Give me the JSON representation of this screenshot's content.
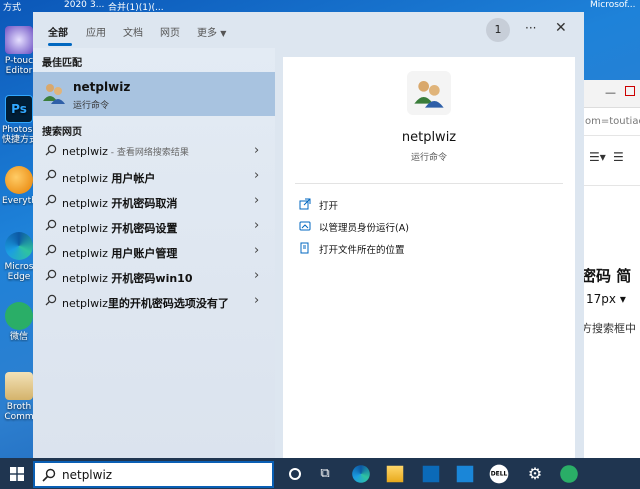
{
  "desktop": {
    "top_strip": [
      "方式",
      "2020",
      "3...",
      "合并(1)(1)(...",
      "Microsof..."
    ],
    "icons": [
      {
        "label": "P-touch Editor",
        "lines": [
          "P-touc",
          "Editor"
        ]
      },
      {
        "label": "Photoshop 快捷方式",
        "lines": [
          "Photosh",
          "快捷方式"
        ]
      },
      {
        "label": "Everything",
        "lines": [
          "Everythi"
        ]
      },
      {
        "label": "Microsoft Edge",
        "lines": [
          "Micros",
          "Edge"
        ]
      },
      {
        "label": "微信",
        "lines": [
          "微信"
        ]
      },
      {
        "label": "Brother Comm",
        "lines": [
          "Broth",
          "Comm"
        ]
      }
    ]
  },
  "bg_window": {
    "url_fragment": "om=toutiao_p",
    "headline": "密码 简",
    "font_size": "17px",
    "body_text": "方搜索框中"
  },
  "search_panel": {
    "tabs": [
      {
        "label": "全部",
        "active": true
      },
      {
        "label": "应用"
      },
      {
        "label": "文档"
      },
      {
        "label": "网页"
      },
      {
        "label": "更多"
      }
    ],
    "badge_count": "1",
    "best_match_label": "最佳匹配",
    "best_match": {
      "name": "netplwiz",
      "type": "运行命令"
    },
    "web_label": "搜索网页",
    "web_results": [
      {
        "prefix": "netplwiz",
        "suffix": "",
        "hint": " - 查看网络搜索结果"
      },
      {
        "prefix": "netplwiz ",
        "suffix": "用户帐户",
        "hint": ""
      },
      {
        "prefix": "netplwiz ",
        "suffix": "开机密码取消",
        "hint": ""
      },
      {
        "prefix": "netplwiz ",
        "suffix": "开机密码设置",
        "hint": ""
      },
      {
        "prefix": "netplwiz ",
        "suffix": "用户账户管理",
        "hint": ""
      },
      {
        "prefix": "netplwiz ",
        "suffix": "开机密码win10",
        "hint": ""
      },
      {
        "prefix": "netplwiz",
        "suffix": "里的开机密码选项没有了",
        "hint": ""
      }
    ],
    "detail": {
      "title": "netplwiz",
      "subtitle": "运行命令",
      "actions": [
        {
          "label": "打开",
          "icon": "open-icon"
        },
        {
          "label": "以管理员身份运行(A)",
          "icon": "shield-icon"
        },
        {
          "label": "打开文件所在的位置",
          "icon": "file-location-icon"
        }
      ]
    }
  },
  "taskbar": {
    "search_value": "netplwiz",
    "apps": [
      "cortana-icon",
      "task-view-icon",
      "edge-icon",
      "file-explorer-icon",
      "store-icon",
      "mail-icon",
      "dell-icon",
      "settings-icon",
      "wechat-icon"
    ]
  }
}
